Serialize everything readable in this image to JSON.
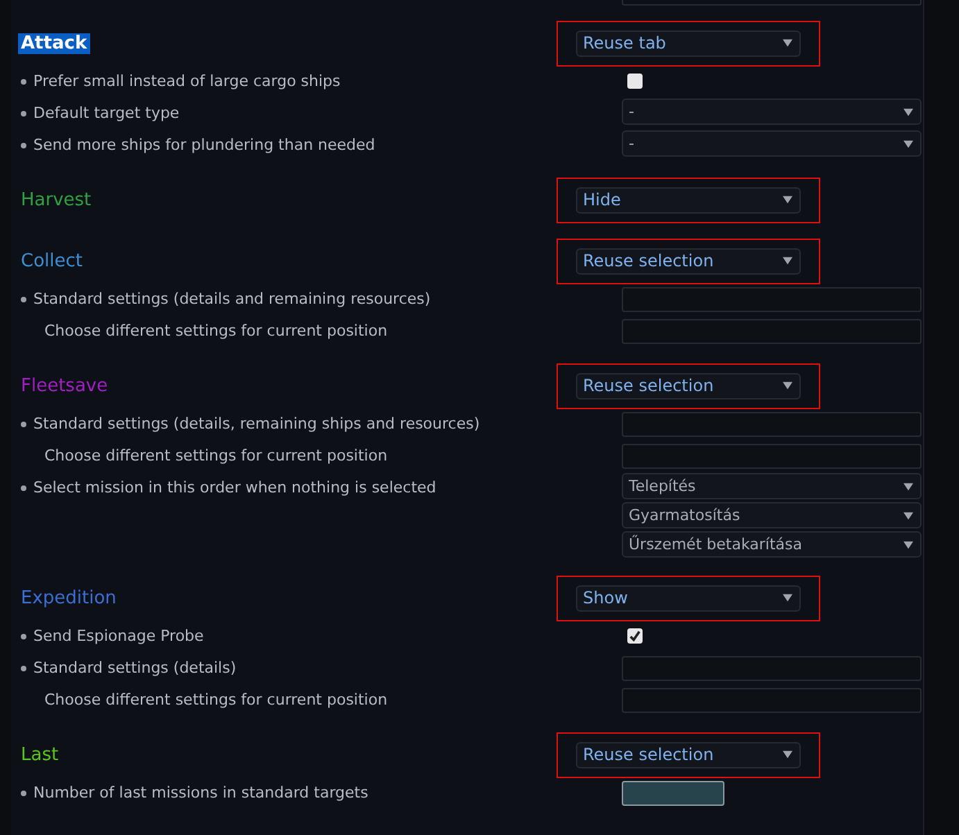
{
  "sections": [
    {
      "title": "Attack",
      "text_selected": true,
      "select": {
        "value": "Reuse tab"
      },
      "highlighted": true,
      "items": [
        {
          "kind": "checkbox",
          "label": "Prefer small instead of large cargo ships",
          "bullet": true,
          "checked": false
        },
        {
          "kind": "select",
          "label": "Default target type",
          "bullet": true,
          "values": [
            "-"
          ]
        },
        {
          "kind": "select",
          "label": "Send more ships for plundering than needed",
          "bullet": true,
          "values": [
            "-"
          ]
        }
      ]
    },
    {
      "title": "Harvest",
      "color": "#2ea143",
      "text_selected": false,
      "select": {
        "value": "Hide"
      },
      "highlighted": true
    },
    {
      "title": "Collect",
      "color": "#3d8fd6",
      "text_selected": false,
      "select": {
        "value": "Reuse selection"
      },
      "highlighted": true,
      "items": [
        {
          "kind": "field",
          "label": "Standard settings (details and remaining resources)",
          "bullet": true
        },
        {
          "kind": "field",
          "label": "Choose different settings for current position",
          "bullet": false
        }
      ]
    },
    {
      "title": "Fleetsave",
      "color": "#a21fc4",
      "text_selected": false,
      "select": {
        "value": "Reuse selection"
      },
      "highlighted": true,
      "items": [
        {
          "kind": "field",
          "label": "Standard settings (details, remaining ships and resources)",
          "bullet": true
        },
        {
          "kind": "field",
          "label": "Choose different settings for current position",
          "bullet": false
        },
        {
          "kind": "select",
          "label": "Select mission in this order when nothing is selected",
          "bullet": true,
          "values": [
            "Telepítés",
            "Gyarmatosítás",
            "Űrszemét betakarítása"
          ]
        }
      ]
    },
    {
      "title": "Expedition",
      "color": "#3a6fd6",
      "text_selected": false,
      "select": {
        "value": "Show"
      },
      "highlighted": true,
      "items": [
        {
          "kind": "checkbox",
          "label": "Send Espionage Probe",
          "bullet": true,
          "checked": true
        },
        {
          "kind": "field",
          "label": "Standard settings (details)",
          "bullet": true
        },
        {
          "kind": "field",
          "label": "Choose different settings for current position",
          "bullet": false
        }
      ]
    },
    {
      "title": "Last",
      "color": "#58c51e",
      "text_selected": false,
      "select": {
        "value": "Reuse selection"
      },
      "highlighted": true,
      "items": [
        {
          "kind": "number",
          "label": "Number of last missions in standard targets",
          "bullet": true
        }
      ]
    }
  ]
}
